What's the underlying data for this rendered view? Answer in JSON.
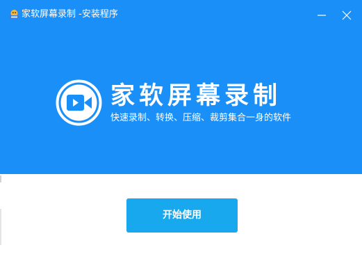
{
  "window": {
    "title": "家软屏幕录制 -安装程序",
    "app_icon": "installer-app-icon",
    "minimize_icon": "minimize-icon",
    "close_icon": "close-icon"
  },
  "brand": {
    "logo_icon": "video-camera-logo-icon",
    "name": "家软屏幕录制",
    "tagline": "快速录制、转换、压缩、裁剪集合一身的软件"
  },
  "actions": {
    "start_label": "开始使用"
  },
  "colors": {
    "header_bg": "#1b8ff8",
    "button_bg": "#18a8ee",
    "text_on_accent": "#ffffff",
    "body_bg": "#ffffff"
  }
}
